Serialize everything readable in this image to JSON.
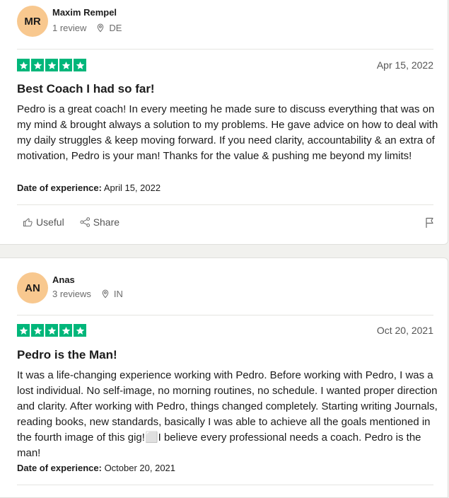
{
  "reviews": [
    {
      "initials": "MR",
      "name": "Maxim Rempel",
      "review_count": "1 review",
      "country": "DE",
      "date": "Apr 15, 2022",
      "rating": 5,
      "title": "Best Coach I had so far!",
      "text": "Pedro is a great coach! In every meeting he made sure to discuss everything that was on my mind & brought always a solution to my problems. He gave advice on how to deal with my daily struggles & keep moving forward. If you need clarity, accountability & an extra of motivation, Pedro is your man! Thanks for the value & pushing me beyond my limits!",
      "experience_label": "Date of experience:",
      "experience_date": "April 15, 2022"
    },
    {
      "initials": "AN",
      "name": "Anas",
      "review_count": "3 reviews",
      "country": "IN",
      "date": "Oct 20, 2021",
      "rating": 5,
      "title": "Pedro is the Man!",
      "text": "It was a life-changing experience working with Pedro. Before working with Pedro, I was a lost individual. No self-image, no morning routines, no schedule. I wanted proper direction and clarity. After working with Pedro, things changed completely. Starting writing Journals, reading books, new standards, basically I was able to achieve all the goals mentioned in the fourth image of this gig!⬜I believe every professional needs a coach. Pedro is the man!",
      "experience_label": "Date of experience:",
      "experience_date": "October 20, 2021"
    }
  ],
  "actions": {
    "useful": "Useful",
    "share": "Share"
  },
  "colors": {
    "star": "#00b67a",
    "avatar": "#f8c88f",
    "background": "#f1f1ee"
  }
}
